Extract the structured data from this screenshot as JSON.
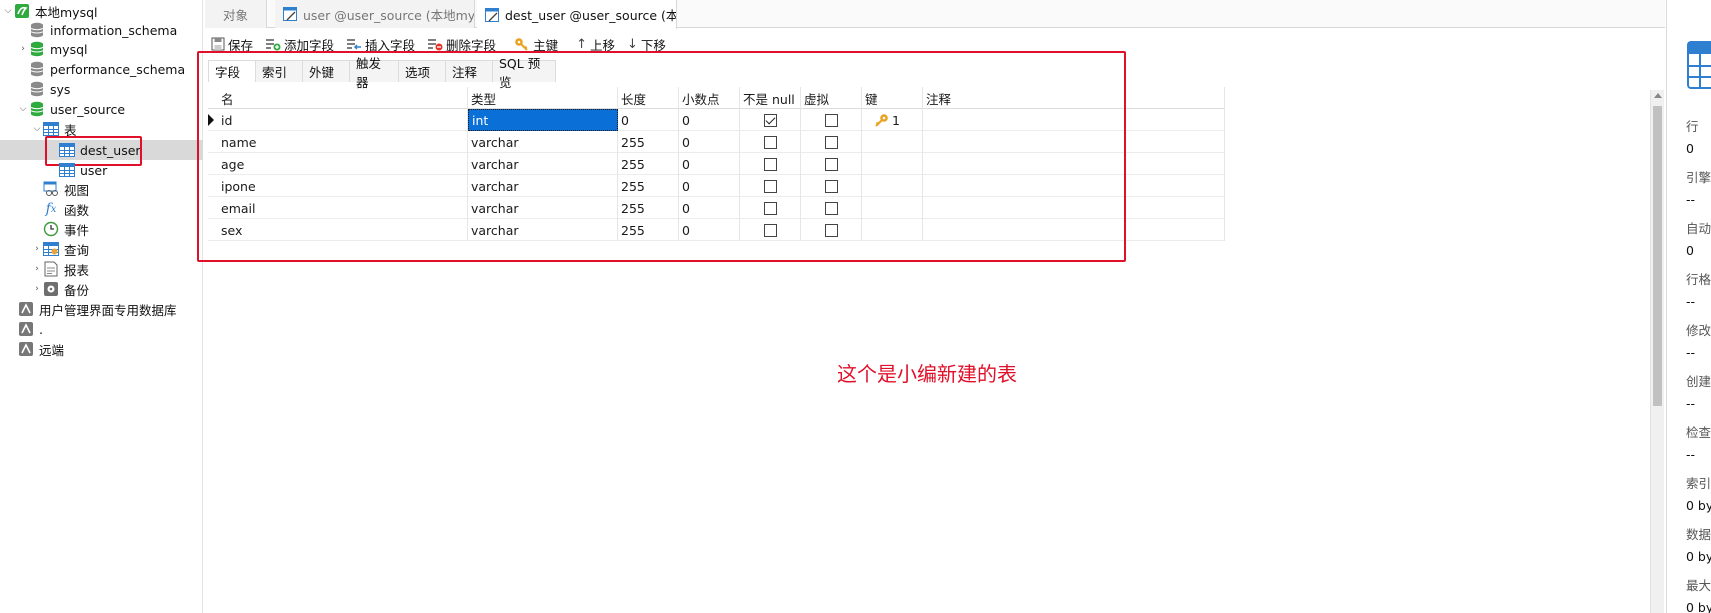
{
  "tree": {
    "items": [
      {
        "label": "本地mysql",
        "expanded": true
      },
      {
        "label": "information_schema"
      },
      {
        "label": "mysql"
      },
      {
        "label": "performance_schema"
      },
      {
        "label": "sys"
      },
      {
        "label": "user_source",
        "expanded": true
      },
      {
        "label": "表",
        "expanded": true
      },
      {
        "label": "dest_user",
        "selected": true
      },
      {
        "label": "user"
      },
      {
        "label": "视图"
      },
      {
        "label": "函数"
      },
      {
        "label": "事件"
      },
      {
        "label": "查询"
      },
      {
        "label": "报表"
      },
      {
        "label": "备份"
      },
      {
        "label": "用户管理界面专用数据库"
      },
      {
        "label": "."
      },
      {
        "label": "远端"
      }
    ]
  },
  "tabs": [
    {
      "label": "对象"
    },
    {
      "label": "user @user_source (本地my..."
    },
    {
      "label": "dest_user @user_source (本..."
    }
  ],
  "toolbar": {
    "save": "保存",
    "add_field": "添加字段",
    "insert_field": "插入字段",
    "delete_field": "删除字段",
    "primary_key": "主键",
    "move_up": "上移",
    "move_down": "下移"
  },
  "inner_tabs": [
    "字段",
    "索引",
    "外键",
    "触发器",
    "选项",
    "注释",
    "SQL 预览"
  ],
  "grid": {
    "columns": [
      "名",
      "类型",
      "长度",
      "小数点",
      "不是 null",
      "虚拟",
      "键",
      "注释"
    ],
    "rows": [
      {
        "name": "id",
        "type": "int",
        "length": "0",
        "decimals": "0",
        "not_null": true,
        "virtual": false,
        "key": "1",
        "comment": ""
      },
      {
        "name": "name",
        "type": "varchar",
        "length": "255",
        "decimals": "0",
        "not_null": false,
        "virtual": false,
        "key": "",
        "comment": ""
      },
      {
        "name": "age",
        "type": "varchar",
        "length": "255",
        "decimals": "0",
        "not_null": false,
        "virtual": false,
        "key": "",
        "comment": ""
      },
      {
        "name": "ipone",
        "type": "varchar",
        "length": "255",
        "decimals": "0",
        "not_null": false,
        "virtual": false,
        "key": "",
        "comment": ""
      },
      {
        "name": "email",
        "type": "varchar",
        "length": "255",
        "decimals": "0",
        "not_null": false,
        "virtual": false,
        "key": "",
        "comment": ""
      },
      {
        "name": "sex",
        "type": "varchar",
        "length": "255",
        "decimals": "0",
        "not_null": false,
        "virtual": false,
        "key": "",
        "comment": ""
      }
    ]
  },
  "annotation": "这个是小编新建的表",
  "right_panel": [
    {
      "k": "行",
      "v": "0"
    },
    {
      "k": "引擎",
      "v": "--"
    },
    {
      "k": "自动",
      "v": "0"
    },
    {
      "k": "行格",
      "v": "--"
    },
    {
      "k": "修改",
      "v": "--"
    },
    {
      "k": "创建",
      "v": "--"
    },
    {
      "k": "检查",
      "v": "--"
    },
    {
      "k": "索引",
      "v": "0 by"
    },
    {
      "k": "数据",
      "v": "0 by"
    },
    {
      "k": "最大",
      "v": "0 by"
    }
  ],
  "colors": {
    "accent": "#0a6fd6",
    "annotation": "#e0102a",
    "db_green": "#2eaa3f"
  }
}
